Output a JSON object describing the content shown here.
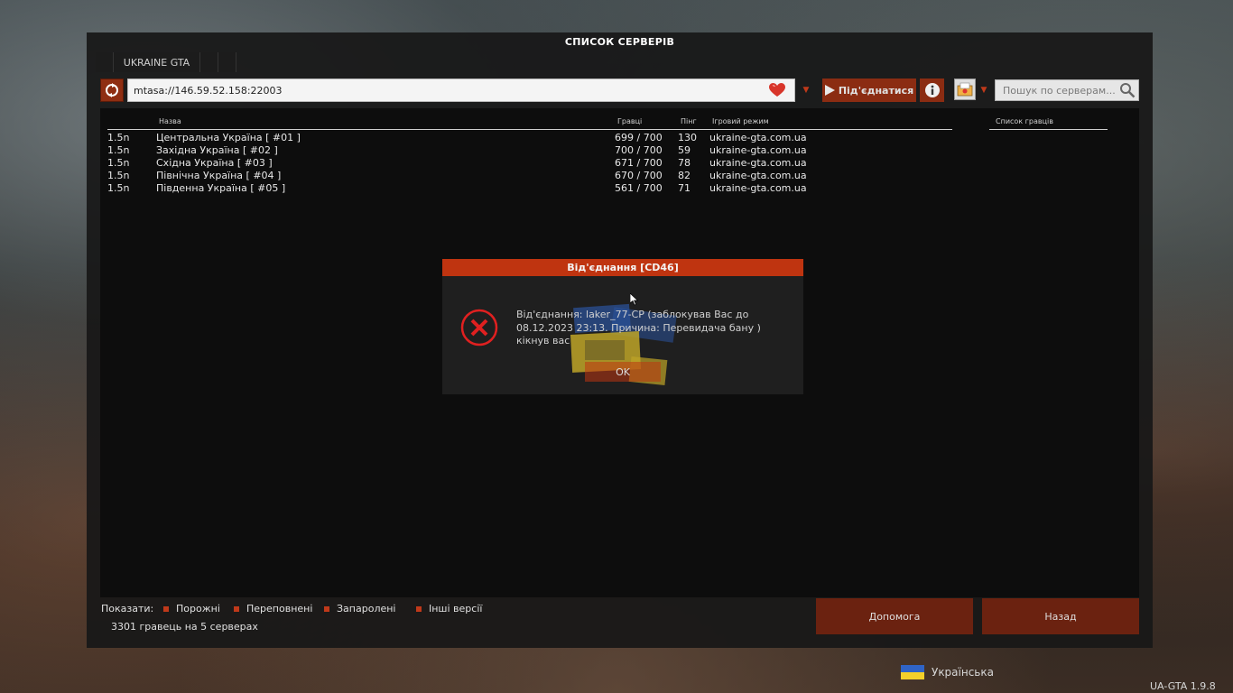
{
  "window": {
    "title": "СПИСОК СЕРВЕРІВ"
  },
  "tabs": [
    {
      "label": "UKRAINE GTA"
    }
  ],
  "toolbar": {
    "address": "mtasa://146.59.52.158:22003",
    "connect_label": "Під'єднатися",
    "search_placeholder": "Пошук по серверам...",
    "icons": [
      "refresh-icon",
      "heart-icon",
      "play-icon",
      "info-icon",
      "favorites-icon",
      "search-icon"
    ]
  },
  "columns": {
    "name": "Назва",
    "players": "Гравці",
    "ping": "Пінг",
    "mode": "Ігровий режим"
  },
  "players_panel": {
    "header": "Список гравців"
  },
  "servers": [
    {
      "version": "1.5n",
      "name": "Центральна Україна [ #01 ]",
      "players": "699 / 700",
      "ping": "130",
      "mode": "ukraine-gta.com.ua"
    },
    {
      "version": "1.5n",
      "name": "Західна Україна [ #02 ]",
      "players": "700 / 700",
      "ping": "59",
      "mode": "ukraine-gta.com.ua"
    },
    {
      "version": "1.5n",
      "name": "Східна Україна [ #03 ]",
      "players": "671 / 700",
      "ping": "78",
      "mode": "ukraine-gta.com.ua"
    },
    {
      "version": "1.5n",
      "name": "Північна Україна [ #04 ]",
      "players": "670 / 700",
      "ping": "82",
      "mode": "ukraine-gta.com.ua"
    },
    {
      "version": "1.5n",
      "name": "Південна Україна [ #05 ]",
      "players": "561 / 700",
      "ping": "71",
      "mode": "ukraine-gta.com.ua"
    }
  ],
  "footer": {
    "show_label": "Показати:",
    "filters": [
      "Порожні",
      "Переповнені",
      "Запаролені",
      "Інші версії"
    ],
    "stats": "3301 гравець на 5 серверах",
    "help_label": "Допомога",
    "back_label": "Назад"
  },
  "dialog": {
    "title": "Від'єднання [CD46]",
    "message": "Від'єднання: laker_77-CP (заблокував Вас до 08.12.2023 23:13. Причина: Перевидача бану ) кікнув вас",
    "ok_label": "OK"
  },
  "language": {
    "label": "Українська"
  },
  "version": "UA-GTA 1.9.8",
  "colors": {
    "accent": "#bf3410",
    "button_dark": "#6b2210",
    "flag_blue": "#2f64c6",
    "flag_yellow": "#f3d02a"
  }
}
